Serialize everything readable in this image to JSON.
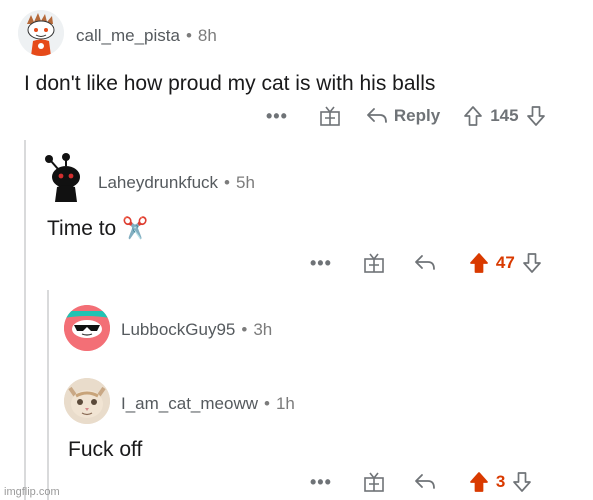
{
  "comments": [
    {
      "username": "call_me_pista",
      "time": "8h",
      "text": "I don't like how proud my cat is with his balls",
      "more": "•••",
      "reply_label": "Reply",
      "score": "145",
      "upvoted": false
    },
    {
      "username": "Laheydrunkfuck",
      "time": "5h",
      "text": "Time to ✂️",
      "more": "•••",
      "score": "47",
      "upvoted": true
    },
    {
      "username": "LubbockGuy95",
      "time": "3h"
    },
    {
      "username": "I_am_cat_meoww",
      "time": "1h",
      "text": "Fuck off",
      "more": "•••",
      "score": "3",
      "upvoted": true
    }
  ],
  "separator": "•",
  "watermark": "imgflip.com",
  "colors": {
    "upvote_active": "#d93a00",
    "icon_gray": "#6f7377",
    "thread_line": "#d9dadb",
    "avatar_pink": "#f36f76",
    "avatar_teal": "#20c3b3"
  }
}
